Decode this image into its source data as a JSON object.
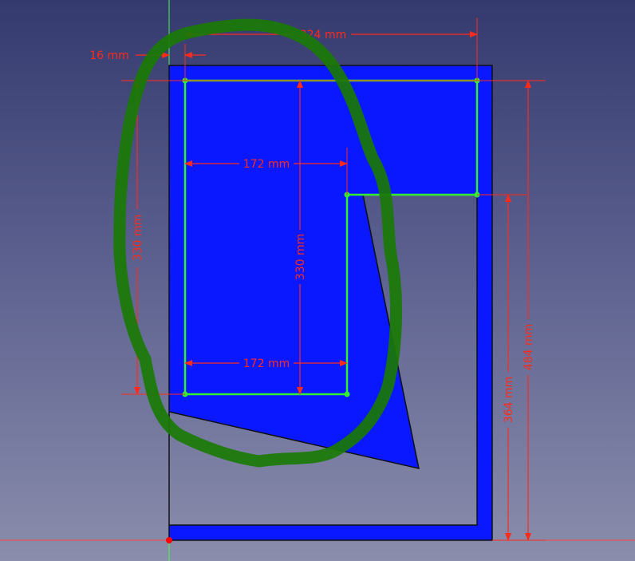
{
  "app": {
    "view": "sketcher-3d-view"
  },
  "colors": {
    "background_top": "#343a6e",
    "background_bottom": "#8a8dab",
    "face": "#0a18ff",
    "face_outline": "#101010",
    "sketch_line": "#33ee33",
    "sketch_point": "#33ee33",
    "dimension": "#ff2a1a",
    "axis_x": "#ff4040",
    "axis_y": "#40ff40",
    "annotation_stroke": "#1a7a05",
    "origin": "#ff0000"
  },
  "dimensions": {
    "offset_left": "16 mm",
    "top_width": "324 mm",
    "inner_top_width": "172 mm",
    "inner_bottom_width": "172 mm",
    "left_height": "330 mm",
    "center_height": "330 mm",
    "right_inner_height": "364 mm",
    "right_outer_height": "484 mm"
  },
  "annotation": {
    "type": "freehand-loop",
    "icon": "highlight-circle"
  }
}
